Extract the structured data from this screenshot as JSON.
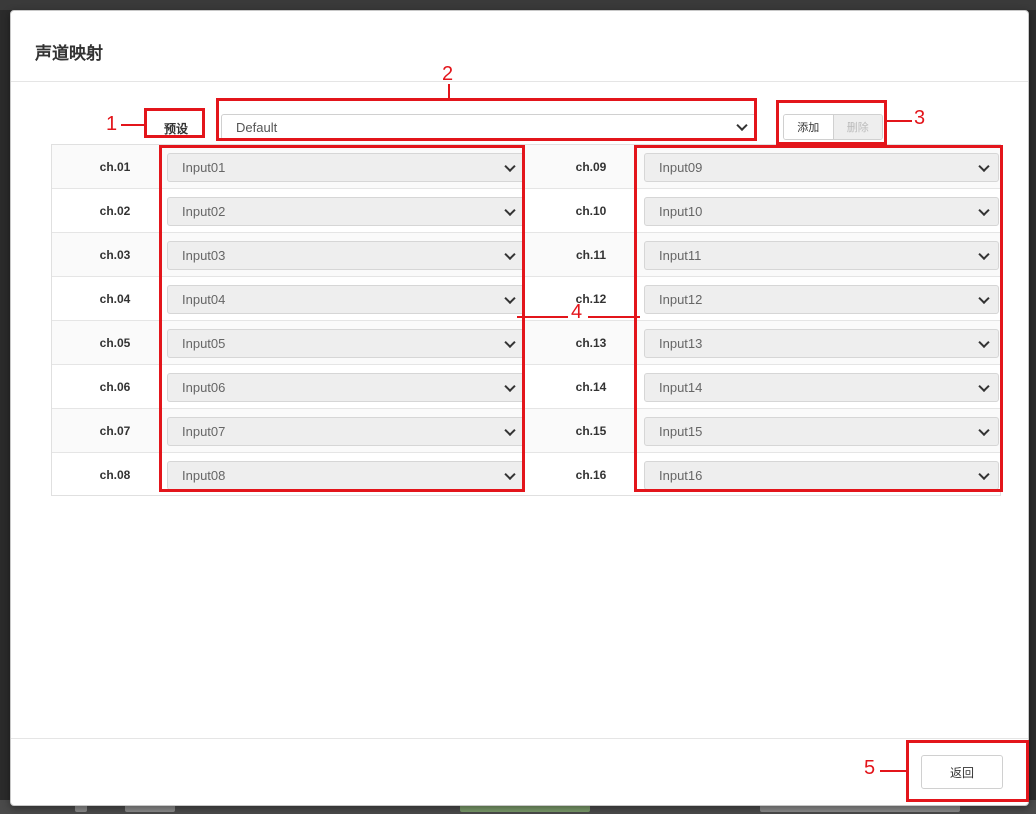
{
  "dialog": {
    "title": "声道映射",
    "preset_label": "预设",
    "preset_value": "Default",
    "add_label": "添加",
    "delete_label": "删除",
    "back_label": "返回"
  },
  "left_channels": [
    {
      "ch": "ch.01",
      "input": "Input01"
    },
    {
      "ch": "ch.02",
      "input": "Input02"
    },
    {
      "ch": "ch.03",
      "input": "Input03"
    },
    {
      "ch": "ch.04",
      "input": "Input04"
    },
    {
      "ch": "ch.05",
      "input": "Input05"
    },
    {
      "ch": "ch.06",
      "input": "Input06"
    },
    {
      "ch": "ch.07",
      "input": "Input07"
    },
    {
      "ch": "ch.08",
      "input": "Input08"
    }
  ],
  "right_channels": [
    {
      "ch": "ch.09",
      "input": "Input09"
    },
    {
      "ch": "ch.10",
      "input": "Input10"
    },
    {
      "ch": "ch.11",
      "input": "Input11"
    },
    {
      "ch": "ch.12",
      "input": "Input12"
    },
    {
      "ch": "ch.13",
      "input": "Input13"
    },
    {
      "ch": "ch.14",
      "input": "Input14"
    },
    {
      "ch": "ch.15",
      "input": "Input15"
    },
    {
      "ch": "ch.16",
      "input": "Input16"
    }
  ],
  "annotations": {
    "n1": "1",
    "n2": "2",
    "n3": "3",
    "n4": "4",
    "n5": "5",
    "color": "#e3151b"
  }
}
